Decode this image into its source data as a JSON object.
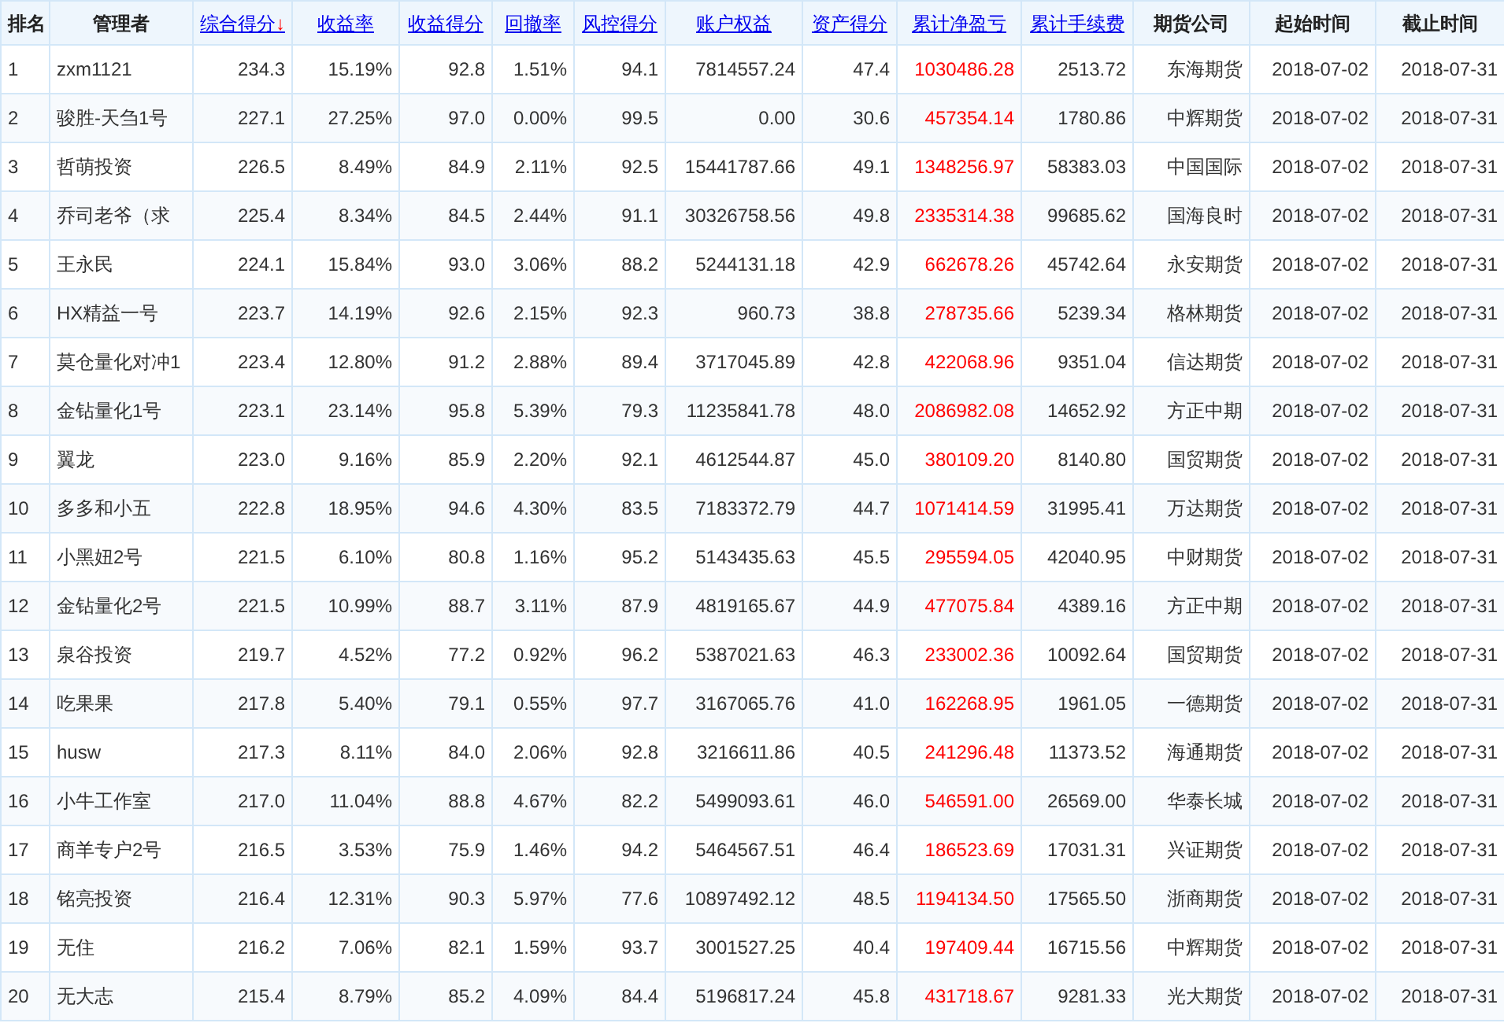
{
  "table": {
    "columns": [
      {
        "label": "排名",
        "kind": "rank",
        "sortable": false
      },
      {
        "label": "管理者",
        "kind": "name",
        "sortable": false
      },
      {
        "label": "综合得分",
        "kind": "number",
        "sortable": true,
        "sort_arrow": "↓"
      },
      {
        "label": "收益率",
        "kind": "number",
        "sortable": true
      },
      {
        "label": "收益得分",
        "kind": "number",
        "sortable": true
      },
      {
        "label": "回撤率",
        "kind": "number",
        "sortable": true
      },
      {
        "label": "风控得分",
        "kind": "number",
        "sortable": true
      },
      {
        "label": "账户权益",
        "kind": "number",
        "sortable": true
      },
      {
        "label": "资产得分",
        "kind": "number",
        "sortable": true
      },
      {
        "label": "累计净盈亏",
        "kind": "profit",
        "sortable": true
      },
      {
        "label": "累计手续费",
        "kind": "number",
        "sortable": true
      },
      {
        "label": "期货公司",
        "kind": "number",
        "sortable": false
      },
      {
        "label": "起始时间",
        "kind": "number",
        "sortable": false
      },
      {
        "label": "截止时间",
        "kind": "number",
        "sortable": false
      }
    ],
    "rows": [
      [
        "1",
        "zxm1121",
        "234.3",
        "15.19%",
        "92.8",
        "1.51%",
        "94.1",
        "7814557.24",
        "47.4",
        "1030486.28",
        "2513.72",
        "东海期货",
        "2018-07-02",
        "2018-07-31"
      ],
      [
        "2",
        "骏胜-天刍1号",
        "227.1",
        "27.25%",
        "97.0",
        "0.00%",
        "99.5",
        "0.00",
        "30.6",
        "457354.14",
        "1780.86",
        "中辉期货",
        "2018-07-02",
        "2018-07-31"
      ],
      [
        "3",
        "哲萌投资",
        "226.5",
        "8.49%",
        "84.9",
        "2.11%",
        "92.5",
        "15441787.66",
        "49.1",
        "1348256.97",
        "58383.03",
        "中国国际",
        "2018-07-02",
        "2018-07-31"
      ],
      [
        "4",
        "乔司老爷（求",
        "225.4",
        "8.34%",
        "84.5",
        "2.44%",
        "91.1",
        "30326758.56",
        "49.8",
        "2335314.38",
        "99685.62",
        "国海良时",
        "2018-07-02",
        "2018-07-31"
      ],
      [
        "5",
        "王永民",
        "224.1",
        "15.84%",
        "93.0",
        "3.06%",
        "88.2",
        "5244131.18",
        "42.9",
        "662678.26",
        "45742.64",
        "永安期货",
        "2018-07-02",
        "2018-07-31"
      ],
      [
        "6",
        "HX精益一号",
        "223.7",
        "14.19%",
        "92.6",
        "2.15%",
        "92.3",
        "960.73",
        "38.8",
        "278735.66",
        "5239.34",
        "格林期货",
        "2018-07-02",
        "2018-07-31"
      ],
      [
        "7",
        "莫仓量化对冲1",
        "223.4",
        "12.80%",
        "91.2",
        "2.88%",
        "89.4",
        "3717045.89",
        "42.8",
        "422068.96",
        "9351.04",
        "信达期货",
        "2018-07-02",
        "2018-07-31"
      ],
      [
        "8",
        "金钻量化1号",
        "223.1",
        "23.14%",
        "95.8",
        "5.39%",
        "79.3",
        "11235841.78",
        "48.0",
        "2086982.08",
        "14652.92",
        "方正中期",
        "2018-07-02",
        "2018-07-31"
      ],
      [
        "9",
        "翼龙",
        "223.0",
        "9.16%",
        "85.9",
        "2.20%",
        "92.1",
        "4612544.87",
        "45.0",
        "380109.20",
        "8140.80",
        "国贸期货",
        "2018-07-02",
        "2018-07-31"
      ],
      [
        "10",
        "多多和小五",
        "222.8",
        "18.95%",
        "94.6",
        "4.30%",
        "83.5",
        "7183372.79",
        "44.7",
        "1071414.59",
        "31995.41",
        "万达期货",
        "2018-07-02",
        "2018-07-31"
      ],
      [
        "11",
        "小黑妞2号",
        "221.5",
        "6.10%",
        "80.8",
        "1.16%",
        "95.2",
        "5143435.63",
        "45.5",
        "295594.05",
        "42040.95",
        "中财期货",
        "2018-07-02",
        "2018-07-31"
      ],
      [
        "12",
        "金钻量化2号",
        "221.5",
        "10.99%",
        "88.7",
        "3.11%",
        "87.9",
        "4819165.67",
        "44.9",
        "477075.84",
        "4389.16",
        "方正中期",
        "2018-07-02",
        "2018-07-31"
      ],
      [
        "13",
        "泉谷投资",
        "219.7",
        "4.52%",
        "77.2",
        "0.92%",
        "96.2",
        "5387021.63",
        "46.3",
        "233002.36",
        "10092.64",
        "国贸期货",
        "2018-07-02",
        "2018-07-31"
      ],
      [
        "14",
        "吃果果",
        "217.8",
        "5.40%",
        "79.1",
        "0.55%",
        "97.7",
        "3167065.76",
        "41.0",
        "162268.95",
        "1961.05",
        "一德期货",
        "2018-07-02",
        "2018-07-31"
      ],
      [
        "15",
        "husw",
        "217.3",
        "8.11%",
        "84.0",
        "2.06%",
        "92.8",
        "3216611.86",
        "40.5",
        "241296.48",
        "11373.52",
        "海通期货",
        "2018-07-02",
        "2018-07-31"
      ],
      [
        "16",
        "小牛工作室",
        "217.0",
        "11.04%",
        "88.8",
        "4.67%",
        "82.2",
        "5499093.61",
        "46.0",
        "546591.00",
        "26569.00",
        "华泰长城",
        "2018-07-02",
        "2018-07-31"
      ],
      [
        "17",
        "商羊专户2号",
        "216.5",
        "3.53%",
        "75.9",
        "1.46%",
        "94.2",
        "5464567.51",
        "46.4",
        "186523.69",
        "17031.31",
        "兴证期货",
        "2018-07-02",
        "2018-07-31"
      ],
      [
        "18",
        "铭亮投资",
        "216.4",
        "12.31%",
        "90.3",
        "5.97%",
        "77.6",
        "10897492.12",
        "48.5",
        "1194134.50",
        "17565.50",
        "浙商期货",
        "2018-07-02",
        "2018-07-31"
      ],
      [
        "19",
        "无住",
        "216.2",
        "7.06%",
        "82.1",
        "1.59%",
        "93.7",
        "3001527.25",
        "40.4",
        "197409.44",
        "16715.56",
        "中辉期货",
        "2018-07-02",
        "2018-07-31"
      ],
      [
        "20",
        "无大志",
        "215.4",
        "8.79%",
        "85.2",
        "4.09%",
        "84.4",
        "5196817.24",
        "45.8",
        "431718.67",
        "9281.33",
        "光大期货",
        "2018-07-02",
        "2018-07-31"
      ]
    ]
  }
}
